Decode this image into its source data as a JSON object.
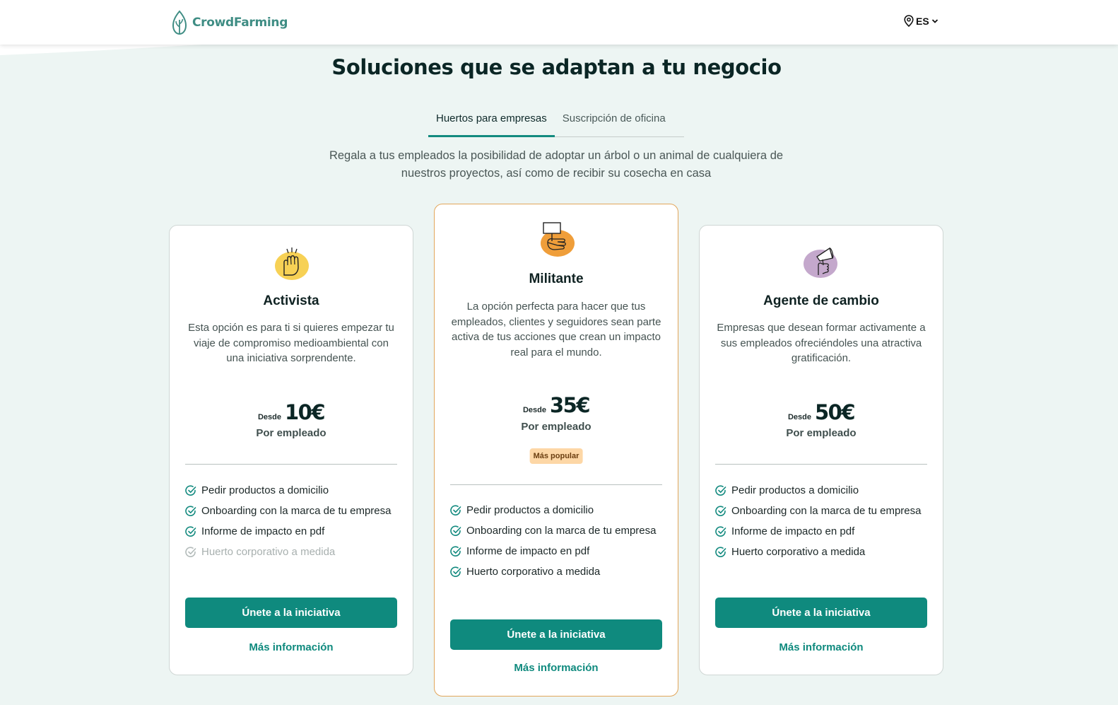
{
  "header": {
    "logo_text": "CrowdFarming",
    "language": "ES"
  },
  "page": {
    "title": "Soluciones que se adaptan a tu negocio",
    "intro": "Regala a tus empleados la posibilidad de adoptar un árbol o un animal de cualquiera de nuestros proyectos, así como de recibir su cosecha en casa"
  },
  "tabs": [
    {
      "label": "Huertos para empresas",
      "active": true
    },
    {
      "label": "Suscripción de oficina",
      "active": false
    }
  ],
  "plans": [
    {
      "icon": "raised-fist-icon",
      "name": "Activista",
      "description": "Esta opción es para ti si quieres empezar tu viaje de compromiso medioambiental con una iniciativa sorprendente.",
      "from_label": "Desde",
      "price": "10€",
      "per_label": "Por empleado",
      "features": [
        {
          "text": "Pedir productos a domicilio",
          "included": true
        },
        {
          "text": "Onboarding con la marca de tu empresa",
          "included": true
        },
        {
          "text": "Informe de impacto en pdf",
          "included": true
        },
        {
          "text": "Huerto corporativo a medida",
          "included": false
        }
      ],
      "cta": "Únete a la iniciativa",
      "more": "Más información"
    },
    {
      "icon": "protest-sign-icon",
      "name": "Militante",
      "description": "La opción perfecta para hacer que tus empleados, clientes y seguidores sean parte activa de tus acciones que crean un impacto real para el mundo.",
      "from_label": "Desde",
      "price": "35€",
      "per_label": "Por empleado",
      "badge": "Más popular",
      "features": [
        {
          "text": "Pedir productos a domicilio",
          "included": true
        },
        {
          "text": "Onboarding con la marca de tu empresa",
          "included": true
        },
        {
          "text": "Informe de impacto en pdf",
          "included": true
        },
        {
          "text": "Huerto corporativo a medida",
          "included": true
        }
      ],
      "cta": "Únete a la iniciativa",
      "more": "Más información"
    },
    {
      "icon": "megaphone-icon",
      "name": "Agente de cambio",
      "description": "Empresas que desean formar activamente a sus empleados ofreciéndoles una atractiva gratificación.",
      "from_label": "Desde",
      "price": "50€",
      "per_label": "Por empleado",
      "features": [
        {
          "text": "Pedir productos a domicilio",
          "included": true
        },
        {
          "text": "Onboarding con la marca de tu empresa",
          "included": true
        },
        {
          "text": "Informe de impacto en pdf",
          "included": true
        },
        {
          "text": "Huerto corporativo a medida",
          "included": true
        }
      ],
      "cta": "Únete a la iniciativa",
      "more": "Más información"
    }
  ],
  "colors": {
    "brand": "#3f8d84",
    "primary_button": "#0f8a7e",
    "featured_border": "#e2a65a",
    "badge_bg": "#fdd7a6",
    "page_bg": "#edf5f3"
  }
}
